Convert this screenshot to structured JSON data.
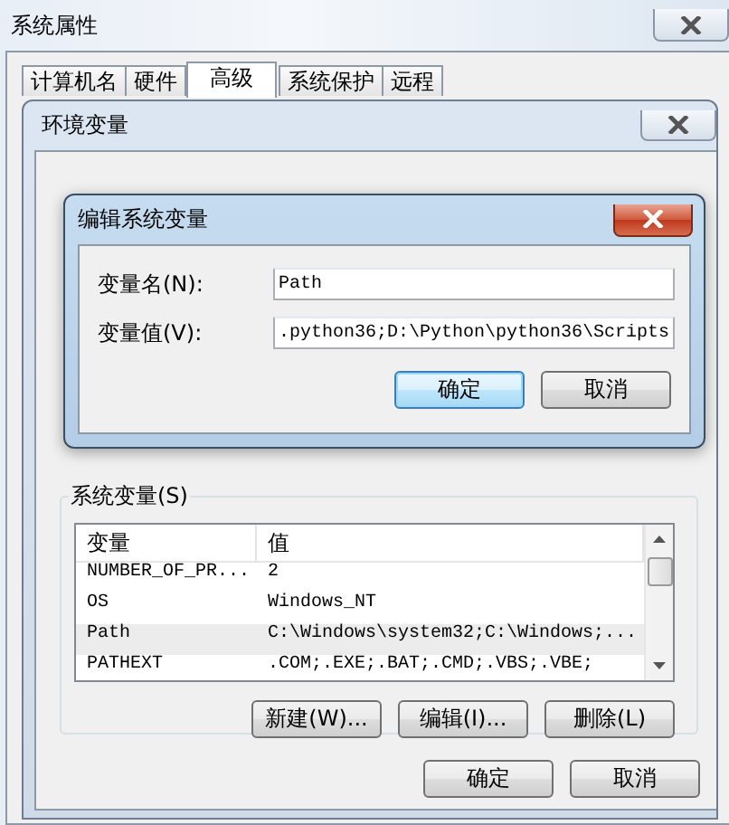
{
  "window": {
    "title": "系统属性"
  },
  "tabs": [
    {
      "label": "计算机名",
      "selected": false
    },
    {
      "label": "硬件",
      "selected": false
    },
    {
      "label": "高级",
      "selected": true
    },
    {
      "label": "系统保护",
      "selected": false
    },
    {
      "label": "远程",
      "selected": false
    }
  ],
  "env_dialog": {
    "title": "环境变量",
    "system_variables": {
      "label": "系统变量(S)",
      "columns": [
        "变量",
        "值"
      ],
      "rows": [
        {
          "name": "NUMBER_OF_PR...",
          "value": "2",
          "selected": false
        },
        {
          "name": "OS",
          "value": "Windows_NT",
          "selected": false
        },
        {
          "name": "Path",
          "value": "C:\\Windows\\system32;C:\\Windows;...",
          "selected": true
        },
        {
          "name": "PATHEXT",
          "value": ".COM;.EXE;.BAT;.CMD;.VBS;.VBE;",
          "selected": false
        }
      ]
    },
    "list_buttons": [
      "新建(W)...",
      "编辑(I)...",
      "删除(L)"
    ],
    "buttons": [
      {
        "label": "确定",
        "default": false
      },
      {
        "label": "取消",
        "default": false
      }
    ]
  },
  "edit_dialog": {
    "title": "编辑系统变量",
    "fields": [
      {
        "label": "变量名(N):",
        "value": "Path"
      },
      {
        "label": "变量值(V):",
        "value": ".python36;D:\\Python\\python36\\Scripts"
      }
    ],
    "buttons": [
      {
        "label": "确定",
        "default": true
      },
      {
        "label": "取消",
        "default": false
      }
    ]
  }
}
